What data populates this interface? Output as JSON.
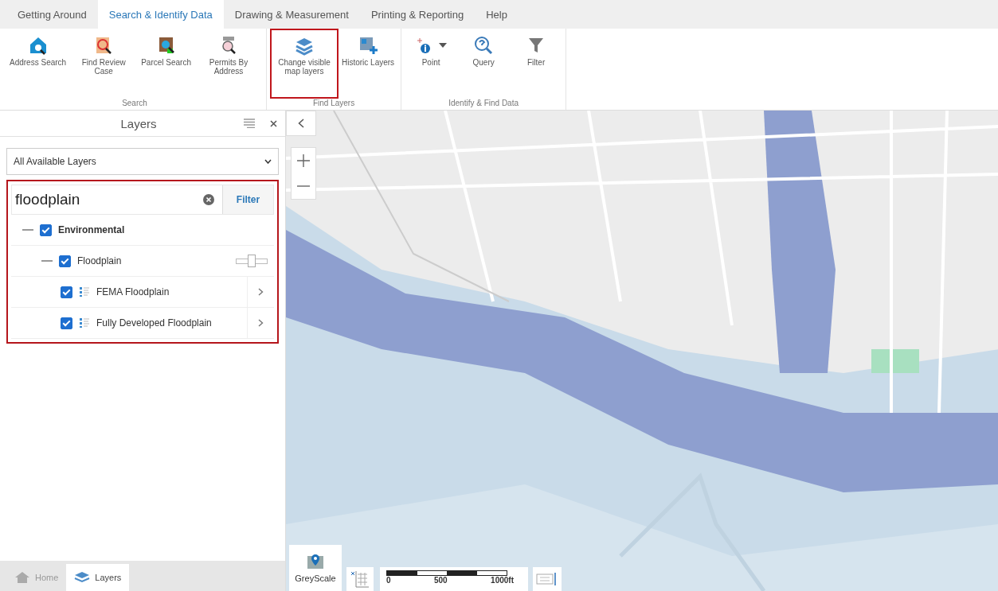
{
  "tabs": [
    {
      "label": "Getting Around",
      "selected": false
    },
    {
      "label": "Search & Identify Data",
      "selected": true
    },
    {
      "label": "Drawing & Measurement",
      "selected": false
    },
    {
      "label": "Printing & Reporting",
      "selected": false
    },
    {
      "label": "Help",
      "selected": false
    }
  ],
  "ribbon": {
    "groups": [
      {
        "label": "Search",
        "buttons": [
          {
            "label": "Address Search",
            "kind": "plain",
            "highlighted": false
          },
          {
            "label": "Find Review Case",
            "kind": "plain",
            "highlighted": false
          },
          {
            "label": "Parcel Search",
            "kind": "plain",
            "highlighted": false
          },
          {
            "label": "Permits By Address",
            "kind": "plain",
            "highlighted": false
          }
        ]
      },
      {
        "label": "Find Layers",
        "buttons": [
          {
            "label": "Change visible map layers",
            "kind": "plain",
            "highlighted": true
          },
          {
            "label": "Historic Layers",
            "kind": "plain",
            "highlighted": false
          }
        ]
      },
      {
        "label": "Identify & Find Data",
        "buttons": [
          {
            "label": "Point",
            "kind": "split",
            "highlighted": false
          },
          {
            "label": "Query",
            "kind": "plain",
            "highlighted": false
          },
          {
            "label": "Filter",
            "kind": "plain",
            "highlighted": false
          }
        ]
      }
    ]
  },
  "layers_panel": {
    "title": "Layers",
    "layer_set": "All Available Layers",
    "filter_box": {
      "highlighted": true,
      "search_value": "floodplain",
      "filter_button": "Filter",
      "tree": [
        {
          "label": "Environmental",
          "kind": "folder",
          "checked": true,
          "expanded": true,
          "children": [
            {
              "label": "Floodplain",
              "kind": "group",
              "checked": true,
              "expanded": true,
              "level": 0.5,
              "children": [
                {
                  "label": "FEMA Floodplain",
                  "kind": "layer",
                  "checked": true
                },
                {
                  "label": "Fully Developed Floodplain",
                  "kind": "layer",
                  "checked": true
                }
              ]
            }
          ]
        }
      ]
    }
  },
  "bottom_tabs": [
    {
      "label": "Home",
      "selected": false
    },
    {
      "label": "Layers",
      "selected": true
    }
  ],
  "map": {
    "basemap_button": "GreyScale",
    "scale_labels": [
      "0",
      "500",
      "1000ft"
    ]
  }
}
